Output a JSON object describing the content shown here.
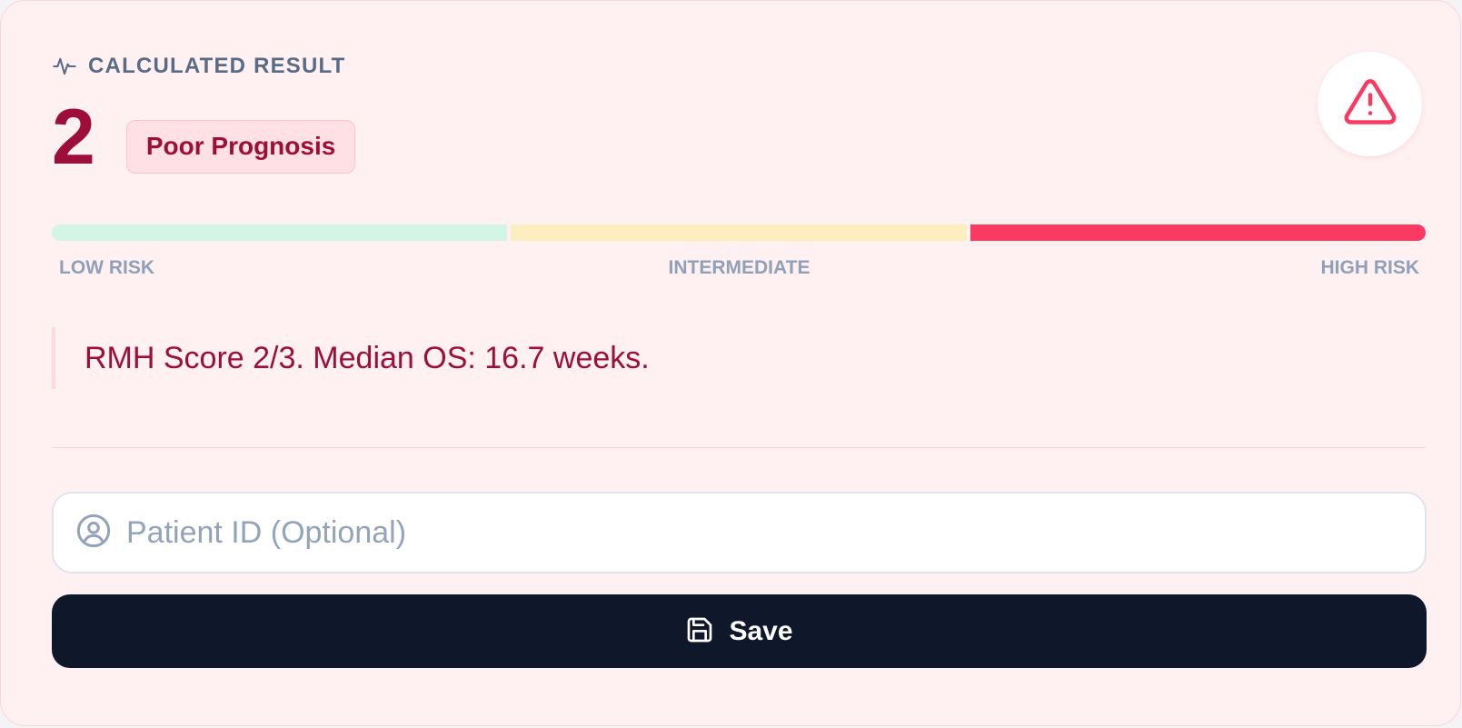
{
  "result": {
    "heading": "CALCULATED RESULT",
    "score": "2",
    "category": "Poor Prognosis"
  },
  "risk_scale": {
    "labels": [
      "LOW RISK",
      "INTERMEDIATE",
      "HIGH RISK"
    ],
    "active_segment": "HIGH RISK"
  },
  "summary": "RMH Score 2/3. Median OS: 16.7 weeks.",
  "patient_id": {
    "value": "",
    "placeholder": "Patient ID (Optional)"
  },
  "actions": {
    "save_label": "Save"
  },
  "icons": {
    "heading": "activity-pulse-icon",
    "alert": "warning-triangle-icon",
    "patient": "user-circle-icon",
    "save": "floppy-disk-icon"
  },
  "colors": {
    "card_background": "#fff0f2",
    "accent": "#9d0f3a",
    "alert": "#fa3a63",
    "low_risk": "#d3f5e5",
    "intermediate": "#fdeebf",
    "high_risk": "#fa3a63",
    "button": "#0f172a"
  }
}
